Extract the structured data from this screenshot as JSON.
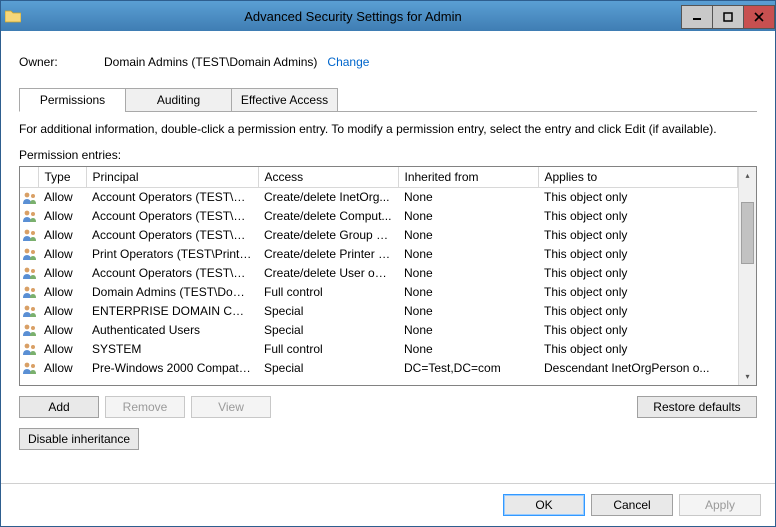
{
  "window": {
    "title": "Advanced Security Settings for Admin"
  },
  "owner": {
    "label": "Owner:",
    "value": "Domain Admins (TEST\\Domain Admins)",
    "change": "Change"
  },
  "tabs": {
    "permissions": "Permissions",
    "auditing": "Auditing",
    "effective": "Effective Access"
  },
  "info_text": "For additional information, double-click a permission entry. To modify a permission entry, select the entry and click Edit (if available).",
  "entries_label": "Permission entries:",
  "columns": {
    "type": "Type",
    "principal": "Principal",
    "access": "Access",
    "inherited": "Inherited from",
    "applies": "Applies to"
  },
  "rows": [
    {
      "type": "Allow",
      "principal": "Account Operators (TEST\\Ac...",
      "access": "Create/delete InetOrg...",
      "inherited": "None",
      "applies": "This object only"
    },
    {
      "type": "Allow",
      "principal": "Account Operators (TEST\\Ac...",
      "access": "Create/delete Comput...",
      "inherited": "None",
      "applies": "This object only"
    },
    {
      "type": "Allow",
      "principal": "Account Operators (TEST\\Ac...",
      "access": "Create/delete Group o...",
      "inherited": "None",
      "applies": "This object only"
    },
    {
      "type": "Allow",
      "principal": "Print Operators (TEST\\Print ...",
      "access": "Create/delete Printer o...",
      "inherited": "None",
      "applies": "This object only"
    },
    {
      "type": "Allow",
      "principal": "Account Operators (TEST\\Ac...",
      "access": "Create/delete User obj...",
      "inherited": "None",
      "applies": "This object only"
    },
    {
      "type": "Allow",
      "principal": "Domain Admins (TEST\\Dom...",
      "access": "Full control",
      "inherited": "None",
      "applies": "This object only"
    },
    {
      "type": "Allow",
      "principal": "ENTERPRISE DOMAIN CONT...",
      "access": "Special",
      "inherited": "None",
      "applies": "This object only"
    },
    {
      "type": "Allow",
      "principal": "Authenticated Users",
      "access": "Special",
      "inherited": "None",
      "applies": "This object only"
    },
    {
      "type": "Allow",
      "principal": "SYSTEM",
      "access": "Full control",
      "inherited": "None",
      "applies": "This object only"
    },
    {
      "type": "Allow",
      "principal": "Pre-Windows 2000 Compatib...",
      "access": "Special",
      "inherited": "DC=Test,DC=com",
      "applies": "Descendant InetOrgPerson o..."
    }
  ],
  "buttons": {
    "add": "Add",
    "remove": "Remove",
    "view": "View",
    "restore": "Restore defaults",
    "disable_inh": "Disable inheritance",
    "ok": "OK",
    "cancel": "Cancel",
    "apply": "Apply"
  }
}
